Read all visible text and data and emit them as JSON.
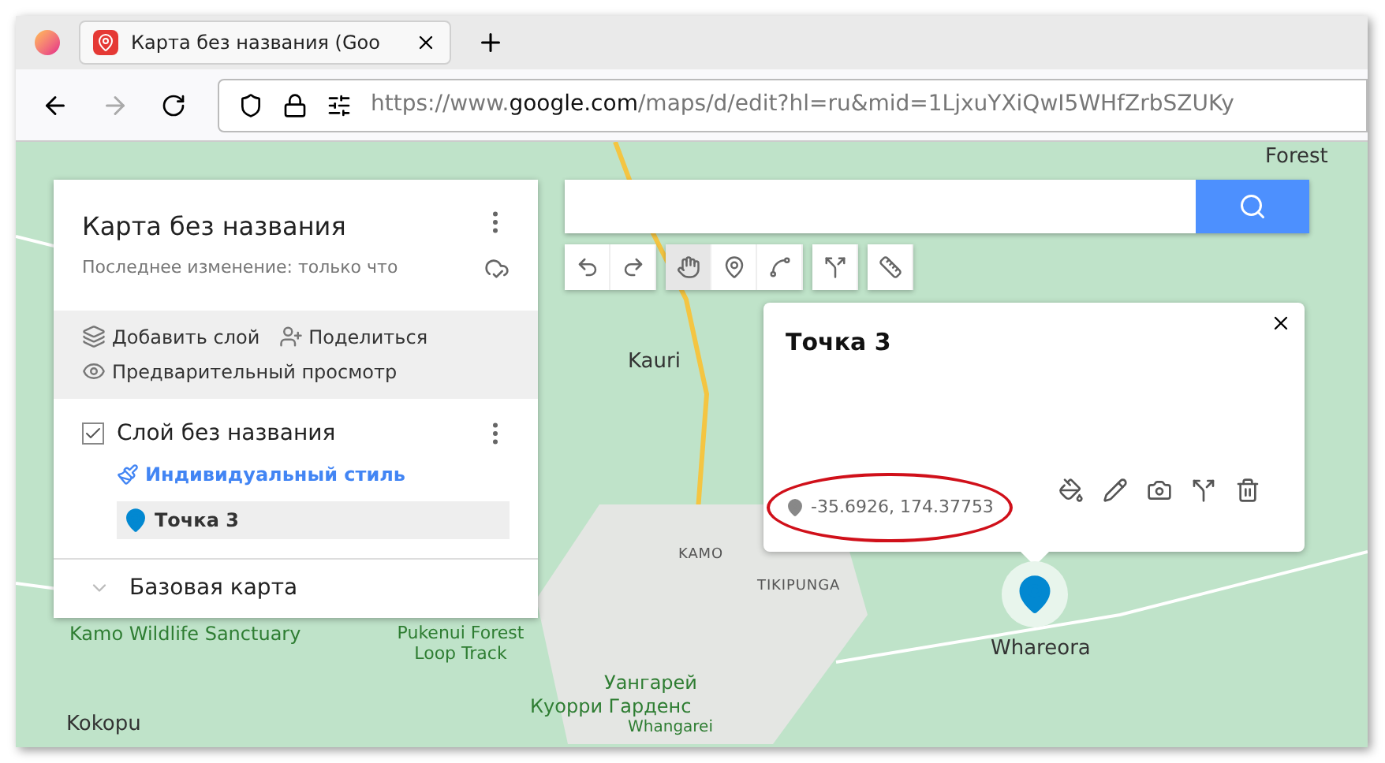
{
  "browser": {
    "tab": {
      "title": "Карта без названия (Goo",
      "selected": true
    },
    "url": {
      "scheme": "https://www.",
      "domain": "google.com",
      "path": "/maps/d/edit?hl=ru&mid=1LjxuYXiQwI5WHfZrbSZUKy"
    }
  },
  "panel": {
    "title": "Карта без названия",
    "subtitle": "Последнее изменение: только что",
    "actions": [
      {
        "kind": "layers",
        "label": "Добавить слой"
      },
      {
        "kind": "share",
        "label": "Поделиться"
      },
      {
        "kind": "preview",
        "label": "Предварительный просмотр"
      }
    ],
    "layer": {
      "name": "Слой без названия",
      "checked": true,
      "style_link": "Индивидуальный стиль",
      "items": [
        {
          "label": "Точка 3",
          "selected": true
        }
      ]
    },
    "base_map": "Базовая карта"
  },
  "toolbar": [
    {
      "kind": "undo",
      "selected": false
    },
    {
      "kind": "redo",
      "selected": false
    },
    {
      "kind": "hand",
      "selected": true
    },
    {
      "kind": "marker",
      "selected": false
    },
    {
      "kind": "line",
      "selected": false
    },
    {
      "kind": "route",
      "selected": false
    },
    {
      "kind": "ruler",
      "selected": false
    }
  ],
  "popup": {
    "title": "Точка 3",
    "coords": "-35.6926, 174.37753"
  },
  "map_labels": [
    {
      "text": "Forest",
      "kind": "place"
    },
    {
      "text": "Kauri",
      "kind": "place"
    },
    {
      "text": "KAMO",
      "kind": "suburb"
    },
    {
      "text": "TIKIPUNGA",
      "kind": "suburb"
    },
    {
      "text": "Kamo Wildlife Sanctuary",
      "kind": "park"
    },
    {
      "text": "Pukenui Forest Loop Track",
      "kind": "park"
    },
    {
      "text": "Whareora",
      "kind": "place"
    },
    {
      "text": "Уангарей",
      "kind": "park"
    },
    {
      "text": "Куорри Гарденс",
      "kind": "park"
    },
    {
      "text": "Whangarei",
      "kind": "park"
    },
    {
      "text": "Kokopu",
      "kind": "place"
    }
  ]
}
